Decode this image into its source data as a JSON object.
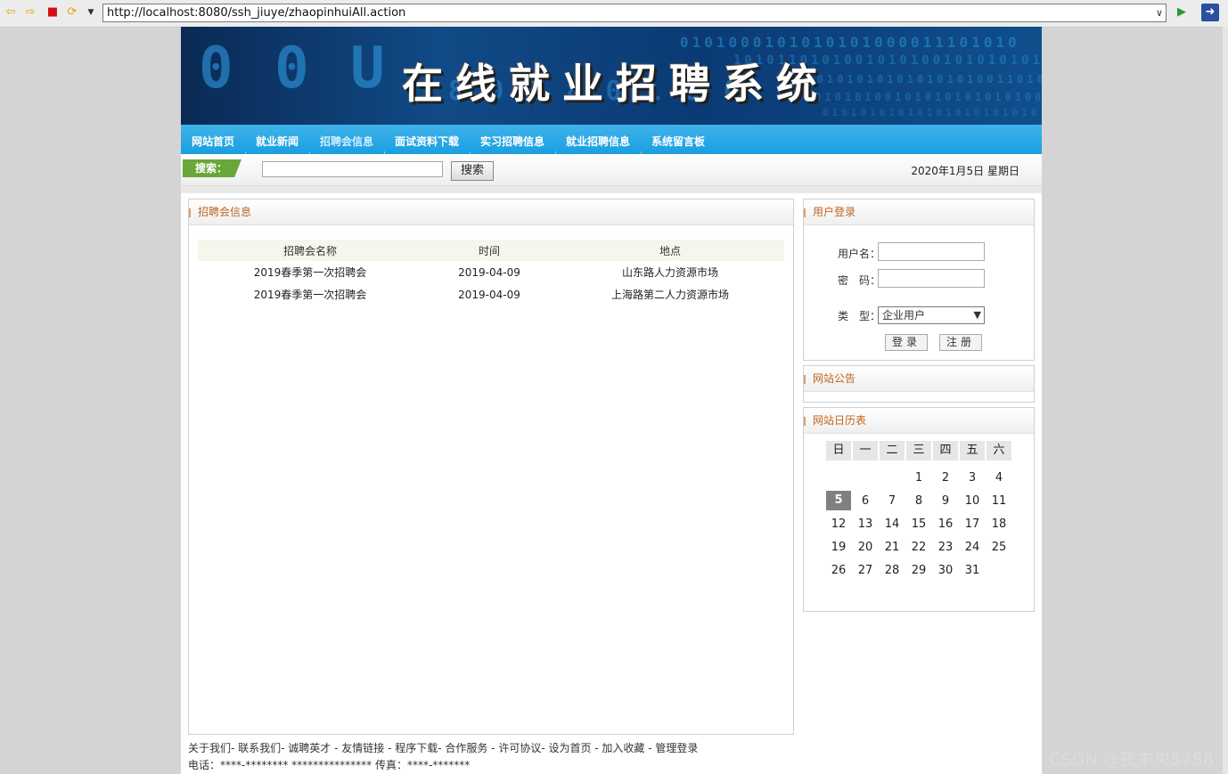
{
  "browser": {
    "url": "http://localhost:8080/ssh_jiuye/zhaopinhuiAll.action",
    "icons": [
      "back-icon",
      "forward-icon",
      "stop-icon",
      "refresh-icon",
      "menu-dropdown-icon",
      "go-icon",
      "ie-icon"
    ]
  },
  "site": {
    "title": "在线就业招聘系统",
    "nav": [
      "网站首页",
      "就业新闻",
      "招聘会信息",
      "面试资料下载",
      "实习招聘信息",
      "就业招聘信息",
      "系统留言板"
    ],
    "active_nav": 2,
    "search_label": "搜索：",
    "search_button": "搜索",
    "date": "2020年1月5日 星期日"
  },
  "main": {
    "title": "招聘会信息",
    "columns": [
      "招聘会名称",
      "时间",
      "地点"
    ],
    "rows": [
      [
        "2019春季第一次招聘会",
        "2019-04-09",
        "山东路人力资源市场"
      ],
      [
        "2019春季第一次招聘会",
        "2019-04-09",
        "上海路第二人力资源市场"
      ]
    ]
  },
  "login": {
    "title": "用户登录",
    "username_label": "用户名：",
    "password_label": "密　码：",
    "type_label": "类　型：",
    "type_value": "企业用户",
    "login_button": "登录",
    "register_button": "注册"
  },
  "notice": {
    "title": "网站公告"
  },
  "calendar": {
    "title": "网站日历表",
    "weekdays": [
      "日",
      "一",
      "二",
      "三",
      "四",
      "五",
      "六"
    ],
    "days": [
      "1",
      "2",
      "3",
      "4",
      "5",
      "6",
      "7",
      "8",
      "9",
      "10",
      "11",
      "12",
      "13",
      "14",
      "15",
      "16",
      "17",
      "18",
      "19",
      "20",
      "21",
      "22",
      "23",
      "24",
      "25",
      "26",
      "27",
      "28",
      "29",
      "30",
      "31"
    ],
    "today": "5",
    "first_weekday": 3
  },
  "footer": {
    "links": "关于我们- 联系我们- 诚聘英才 - 友情链接 - 程序下载- 合作服务 - 许可协议- 设为首页 - 加入收藏 - 管理登录",
    "contact": "电话：****-******** *************** 传真：****-*******"
  },
  "watermark": "CSDN @夜未央5788"
}
